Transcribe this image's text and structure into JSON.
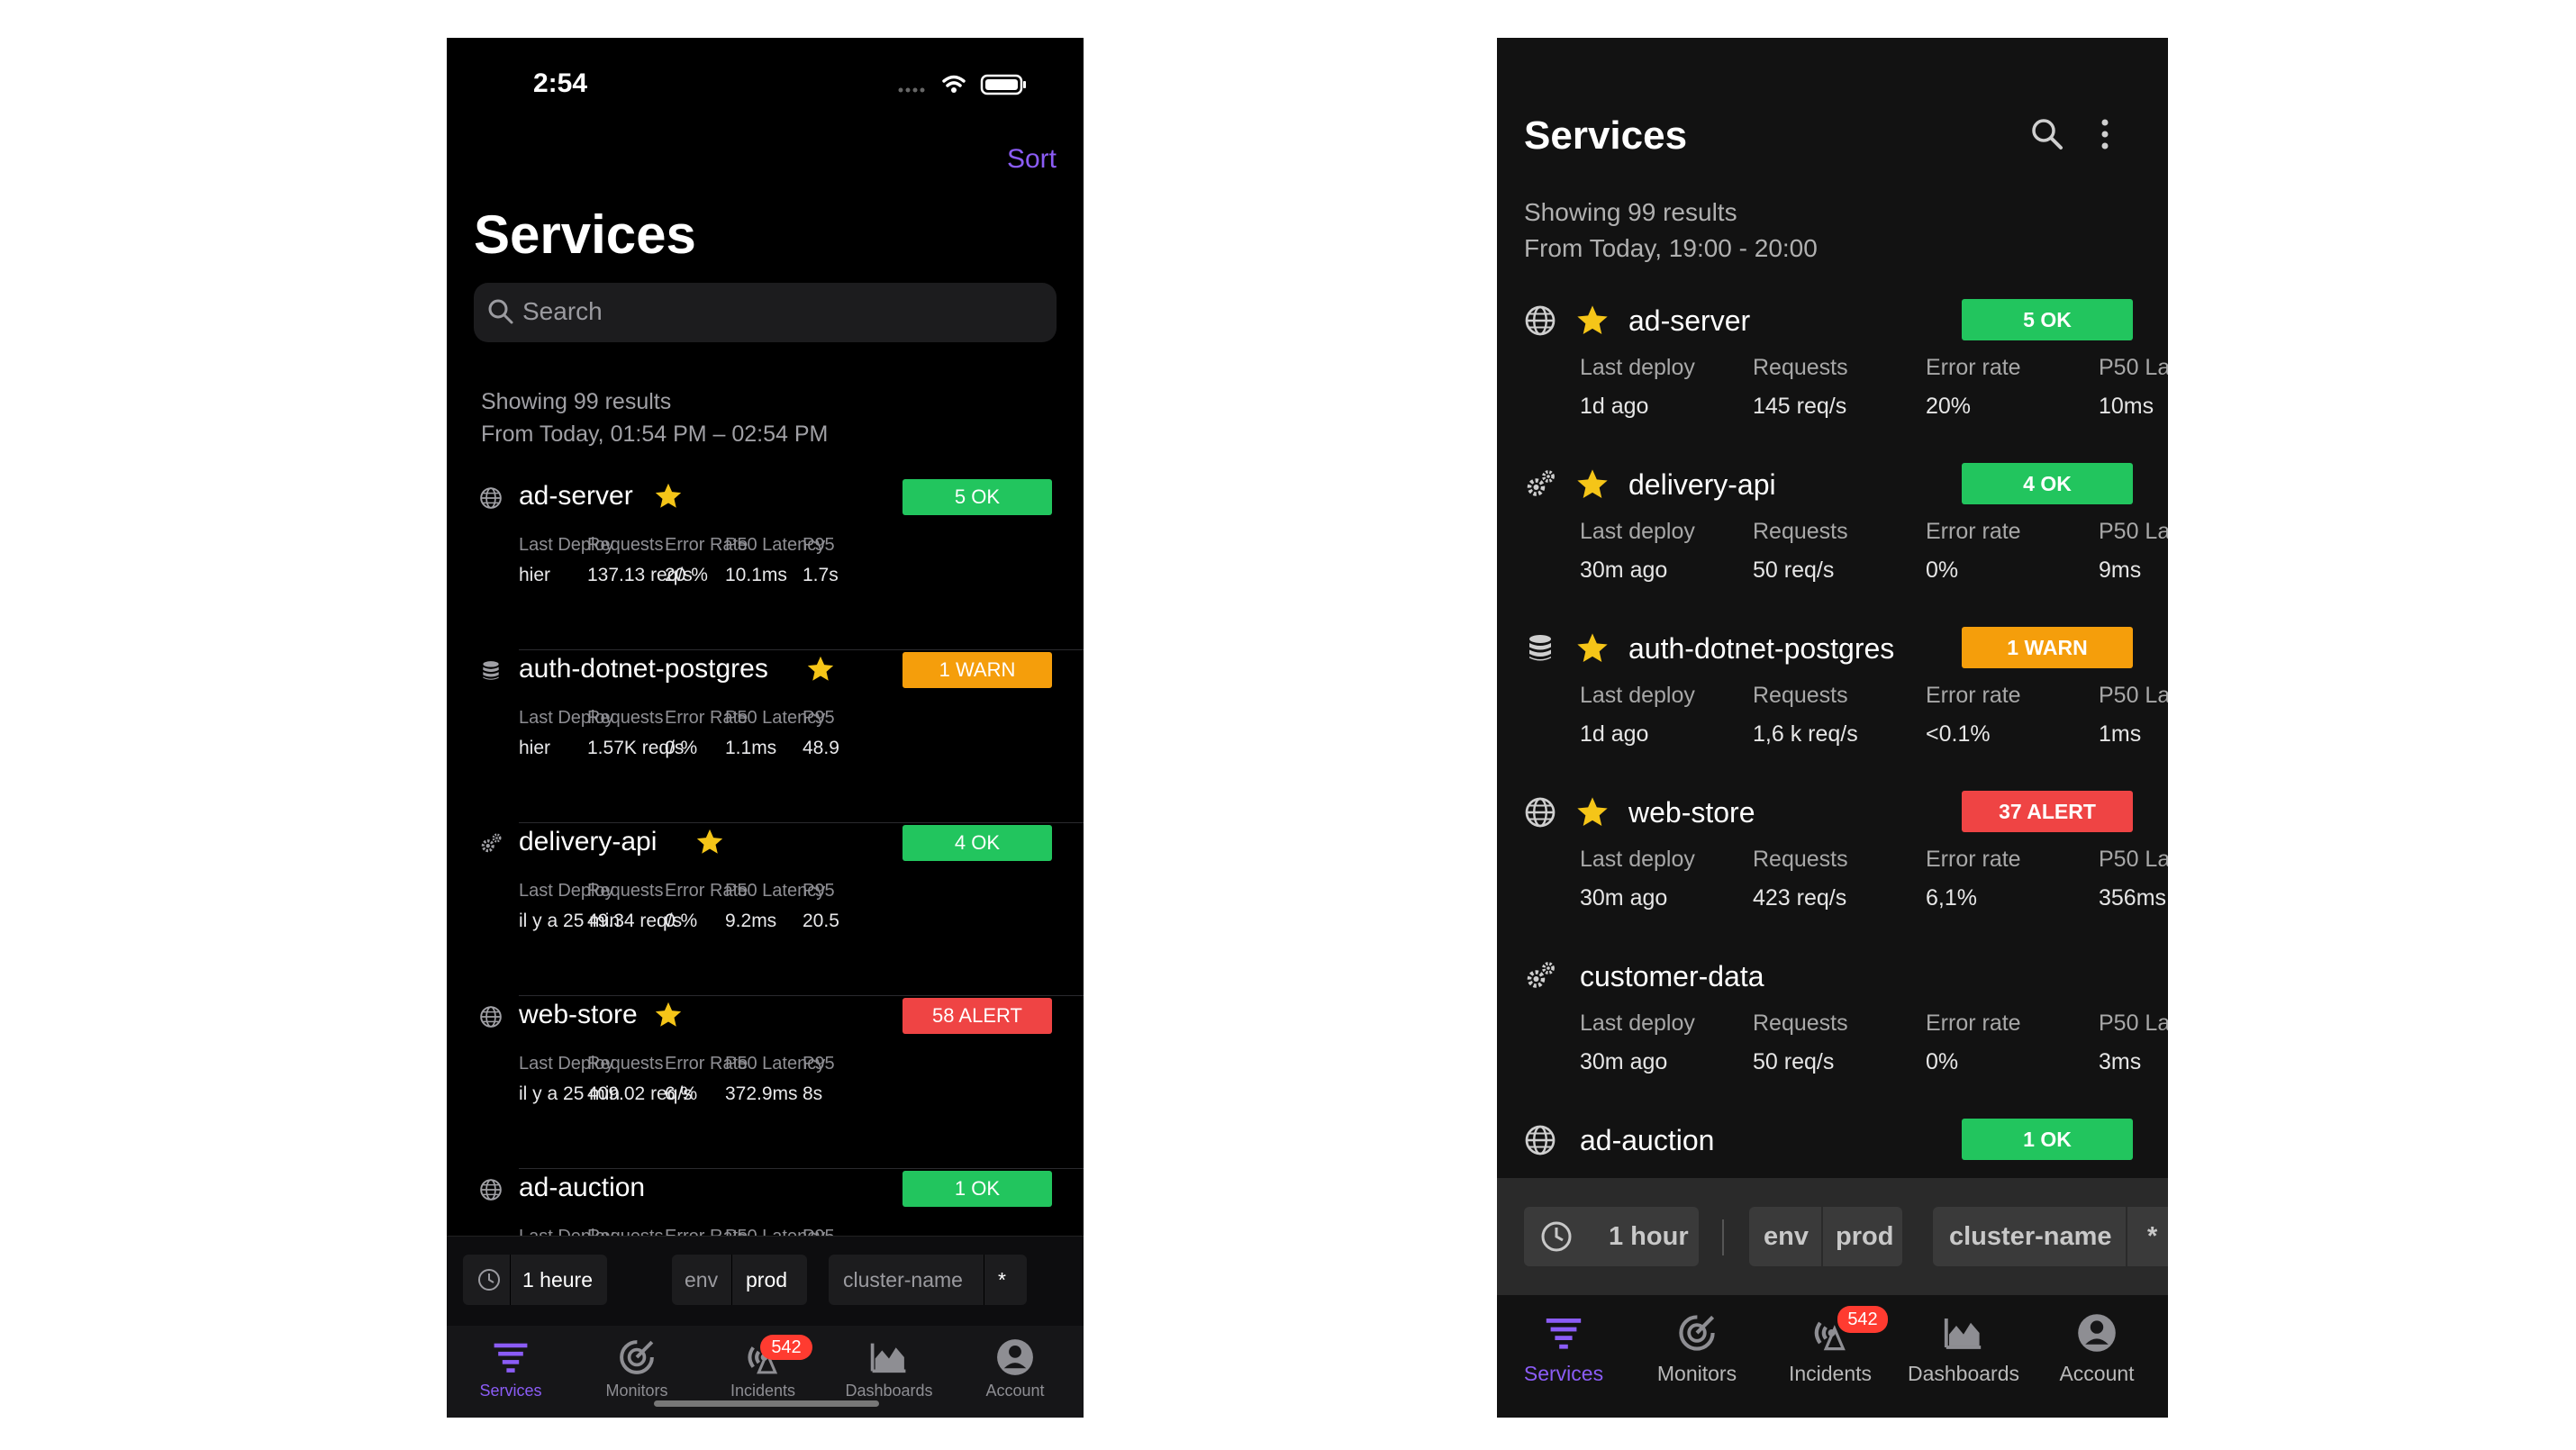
{
  "colors": {
    "accent": "#8b5cf6",
    "ok": "#22c55e",
    "warn": "#f59e0b",
    "alert": "#ef4444",
    "star": "#f5c518"
  },
  "ios": {
    "status_time": "2:54",
    "sort_label": "Sort",
    "title": "Services",
    "search_placeholder": "Search",
    "summary": [
      "Showing 99 results",
      "From Today, 01:54 PM – 02:54 PM"
    ],
    "metric_labels": [
      "Last Deploy",
      "Requests",
      "Error Rate",
      "P50 Latency",
      "P95"
    ],
    "services": [
      {
        "icon": "globe-icon",
        "name": "ad-server",
        "starred": true,
        "badge": "5 OK",
        "status": "ok",
        "values": [
          "hier",
          "137.13 req/s",
          "20 %",
          "10.1ms",
          "1.7s"
        ]
      },
      {
        "icon": "database-icon",
        "name": "auth-dotnet-postgres",
        "starred": true,
        "badge": "1 WARN",
        "status": "warn",
        "values": [
          "hier",
          "1.57K req/s",
          "0 %",
          "1.1ms",
          "48.9"
        ]
      },
      {
        "icon": "gears-icon",
        "name": "delivery-api",
        "starred": true,
        "badge": "4 OK",
        "status": "ok",
        "values": [
          "il y a 25 min",
          "49.34 req/s",
          "0 %",
          "9.2ms",
          "20.5"
        ]
      },
      {
        "icon": "globe-icon",
        "name": "web-store",
        "starred": true,
        "badge": "58 ALERT",
        "status": "alert",
        "values": [
          "il y a 25 min",
          "409.02 req/s",
          "6 %",
          "372.9ms",
          "8s"
        ]
      },
      {
        "icon": "globe-icon",
        "name": "ad-auction",
        "starred": false,
        "badge": "1 OK",
        "status": "ok",
        "values": [
          "",
          "",
          "",
          "",
          ""
        ]
      }
    ],
    "filters": {
      "time": "1 heure",
      "env_key": "env",
      "env_value": "prod",
      "cluster_key": "cluster-name",
      "cluster_value": "*"
    },
    "tabs": [
      {
        "label": "Services",
        "icon": "services-icon",
        "active": true
      },
      {
        "label": "Monitors",
        "icon": "monitors-icon",
        "active": false
      },
      {
        "label": "Incidents",
        "icon": "incidents-icon",
        "active": false,
        "badge": "542"
      },
      {
        "label": "Dashboards",
        "icon": "dashboards-icon",
        "active": false
      },
      {
        "label": "Account",
        "icon": "account-icon",
        "active": false
      }
    ]
  },
  "android": {
    "title": "Services",
    "summary": [
      "Showing 99 results",
      "From Today, 19:00 - 20:00"
    ],
    "metric_labels": [
      "Last deploy",
      "Requests",
      "Error rate",
      "P50 La"
    ],
    "services": [
      {
        "icon": "globe-icon",
        "name": "ad-server",
        "starred": true,
        "badge": "5 OK",
        "status": "ok",
        "values": [
          "1d ago",
          "145 req/s",
          "20%",
          "10ms"
        ]
      },
      {
        "icon": "gears-icon",
        "name": "delivery-api",
        "starred": true,
        "badge": "4 OK",
        "status": "ok",
        "values": [
          "30m ago",
          "50 req/s",
          "0%",
          "9ms"
        ]
      },
      {
        "icon": "database-icon",
        "name": "auth-dotnet-postgres",
        "starred": true,
        "badge": "1 WARN",
        "status": "warn",
        "values": [
          "1d ago",
          "1,6 k req/s",
          "<0.1%",
          "1ms"
        ]
      },
      {
        "icon": "globe-icon",
        "name": "web-store",
        "starred": true,
        "badge": "37 ALERT",
        "status": "alert",
        "values": [
          "30m ago",
          "423 req/s",
          "6,1%",
          "356ms"
        ]
      },
      {
        "icon": "gears-icon",
        "name": "customer-data",
        "starred": false,
        "badge": "",
        "status": "",
        "values": [
          "30m ago",
          "50 req/s",
          "0%",
          "3ms"
        ]
      },
      {
        "icon": "globe-icon",
        "name": "ad-auction",
        "starred": false,
        "badge": "1 OK",
        "status": "ok",
        "values": [
          "",
          "",
          "",
          ""
        ]
      }
    ],
    "filters": {
      "time": "1 hour",
      "env_key": "env",
      "env_value": "prod",
      "cluster_key": "cluster-name",
      "cluster_value": "*"
    },
    "tabs": [
      {
        "label": "Services",
        "icon": "services-icon",
        "active": true
      },
      {
        "label": "Monitors",
        "icon": "monitors-icon",
        "active": false
      },
      {
        "label": "Incidents",
        "icon": "incidents-icon",
        "active": false,
        "badge": "542"
      },
      {
        "label": "Dashboards",
        "icon": "dashboards-icon",
        "active": false
      },
      {
        "label": "Account",
        "icon": "account-icon",
        "active": false
      }
    ]
  }
}
